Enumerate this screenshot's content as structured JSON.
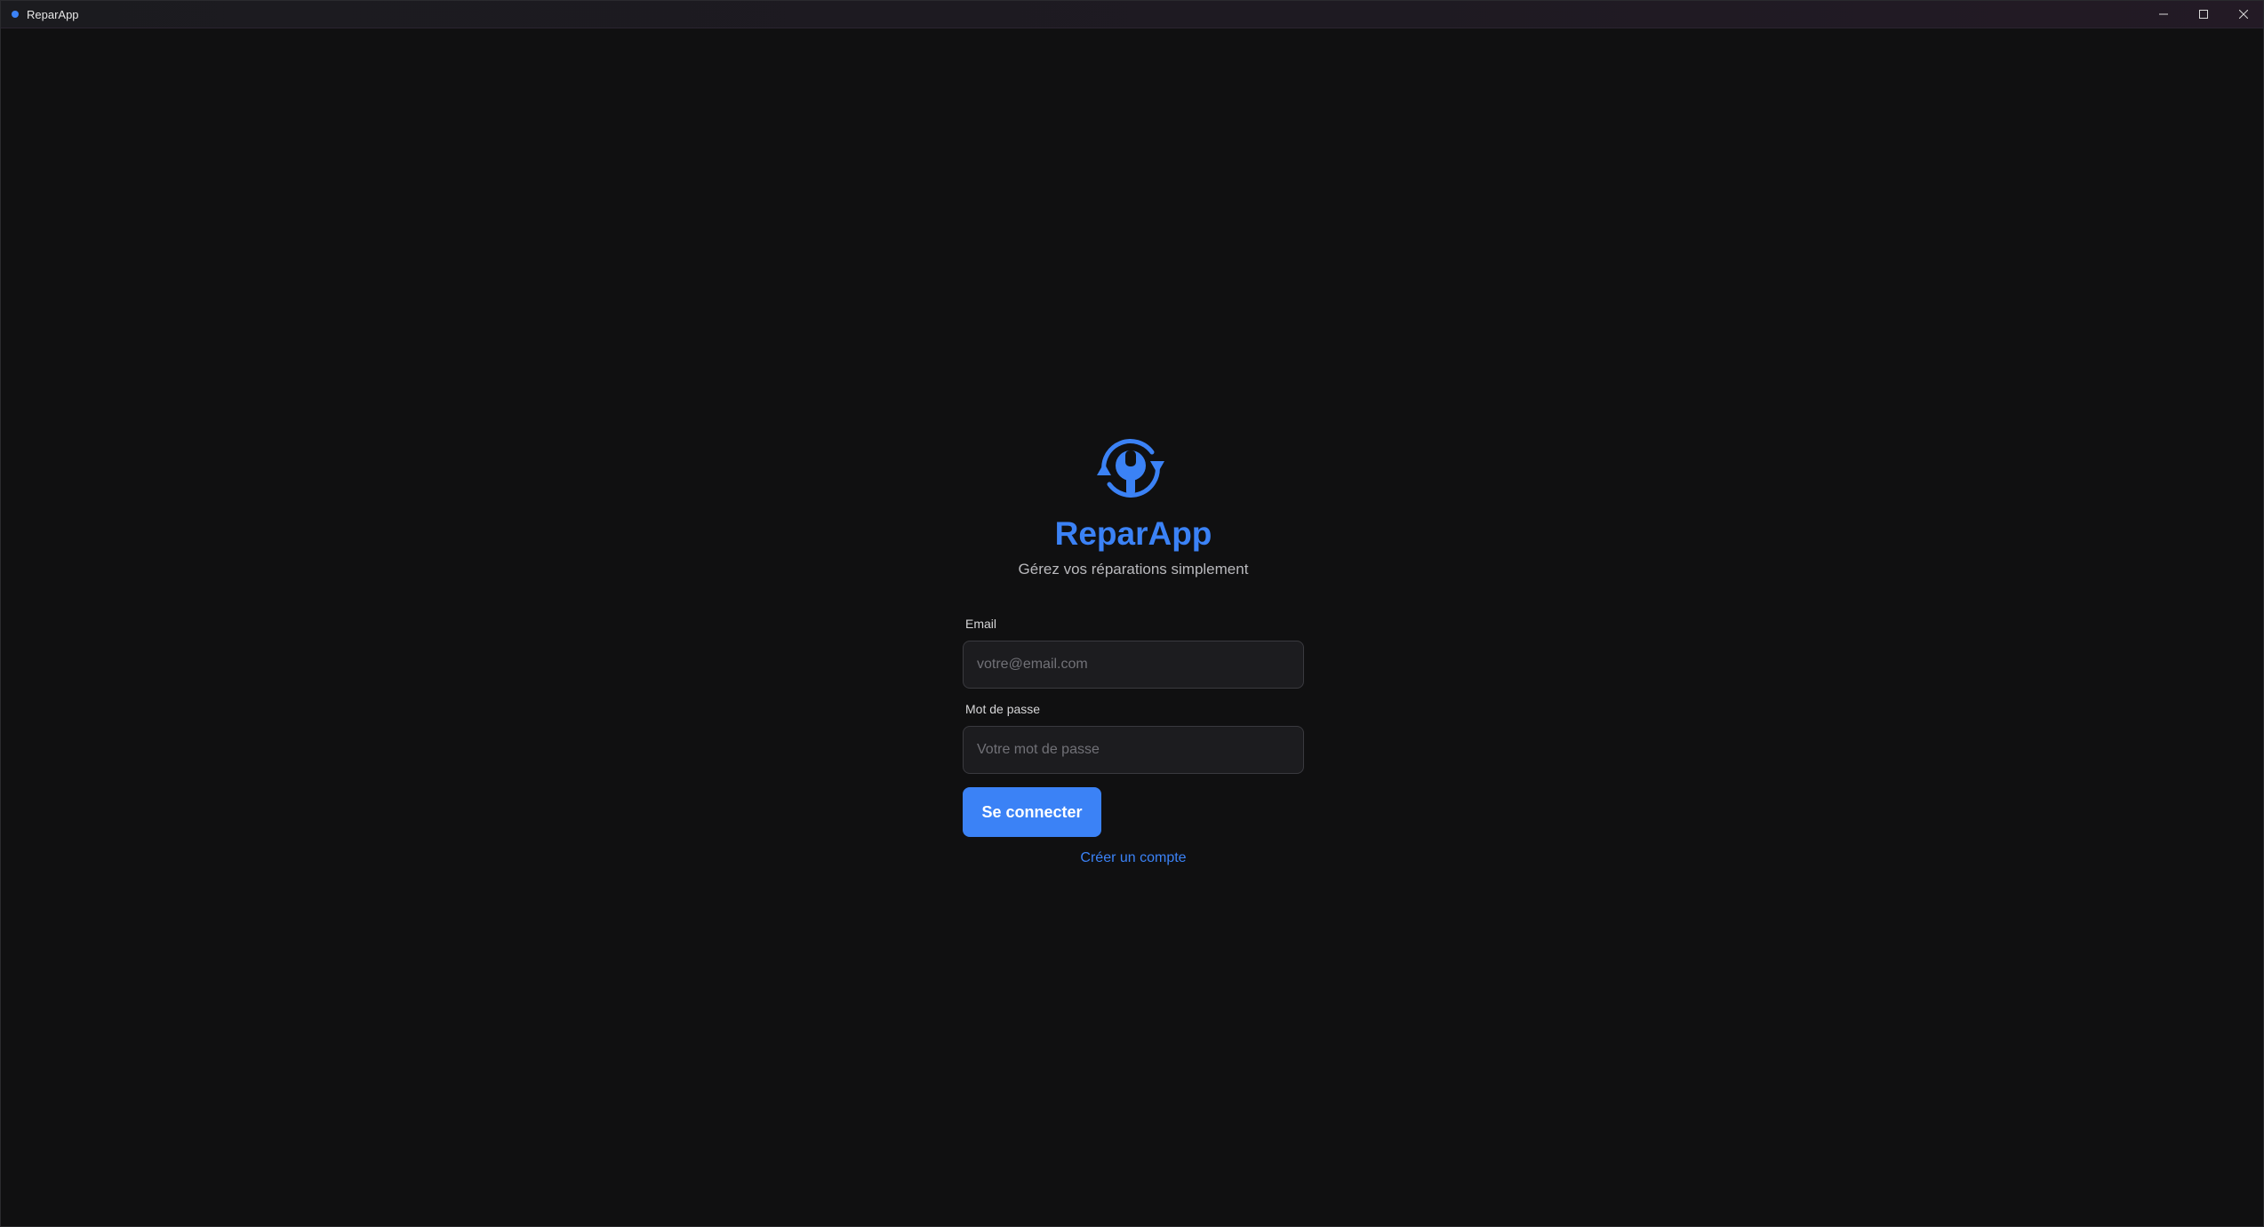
{
  "window": {
    "title": "ReparApp",
    "controls": {
      "minimize_icon": "minimize-icon",
      "maximize_icon": "maximize-icon",
      "close_icon": "close-icon"
    }
  },
  "brand": {
    "logo_icon": "wrench-refresh-icon",
    "name": "ReparApp",
    "tagline": "Gérez vos réparations simplement",
    "accent_color": "#3b82f6"
  },
  "login_form": {
    "email": {
      "label": "Email",
      "value": "",
      "placeholder": "votre@email.com"
    },
    "password": {
      "label": "Mot de passe",
      "value": "",
      "placeholder": "Votre mot de passe"
    },
    "submit_label": "Se connecter",
    "create_account_label": "Créer un compte"
  }
}
